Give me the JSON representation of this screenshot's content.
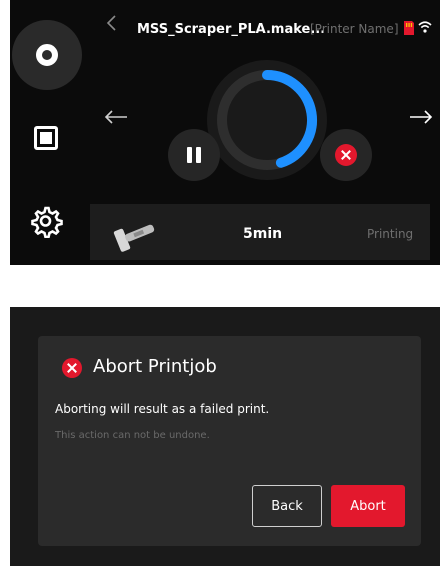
{
  "printer_screen": {
    "job_title": "MSS_Scraper_PLA.make...",
    "printer_name": "[Printer Name]",
    "progress_fraction": 0.45,
    "time_left": "5min",
    "status": "Printing"
  },
  "abort_dialog": {
    "title": "Abort Printjob",
    "message": "Aborting will result as a failed print.",
    "sub_message": "This action can not be undone.",
    "back_label": "Back",
    "abort_label": "Abort"
  },
  "colors": {
    "accent_blue": "#1e90ff",
    "danger_red": "#e3182d",
    "screen_bg": "#0b0b0b"
  },
  "icons": [
    "home-icon",
    "document-icon",
    "gear-icon",
    "chevron-left-icon",
    "sd-card-icon",
    "wifi-icon",
    "arrow-left-icon",
    "arrow-right-icon",
    "pause-icon",
    "cancel-icon",
    "scraper-icon",
    "alert-icon"
  ]
}
